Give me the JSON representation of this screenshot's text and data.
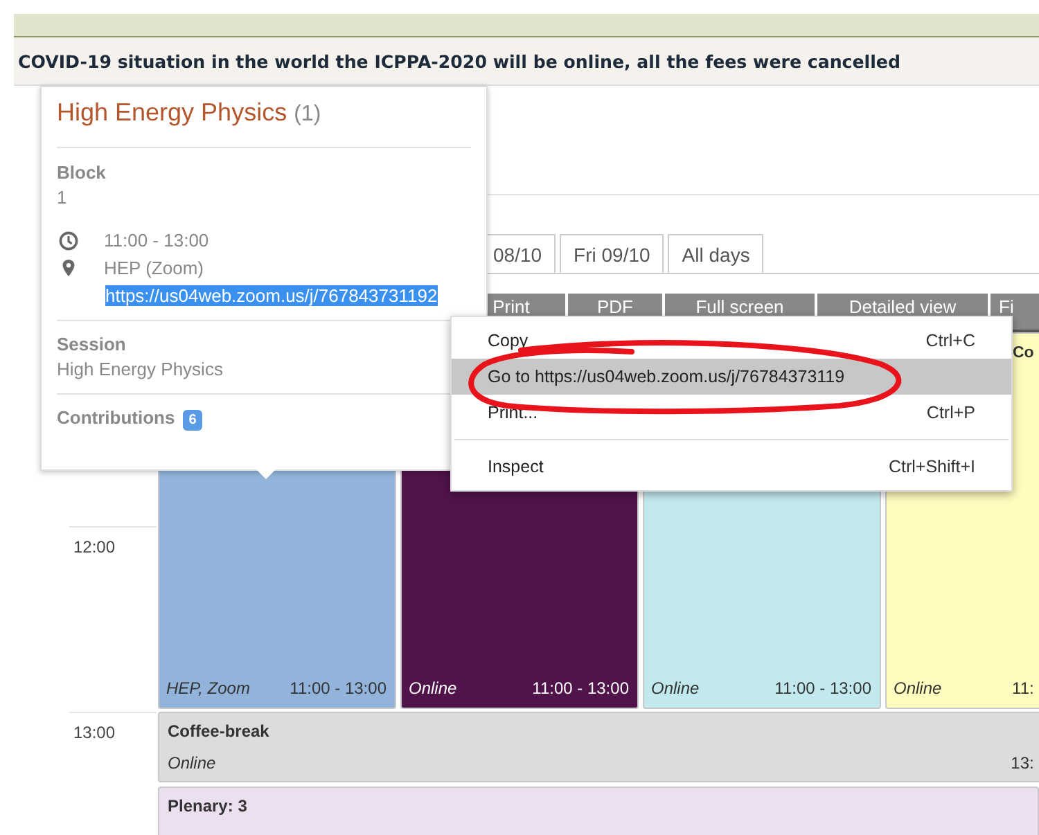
{
  "banner": "COVID-19 situation in the world the ICPPA-2020 will be online, all the fees were cancelled",
  "day_tabs": [
    {
      "label": "08/10",
      "selected": false
    },
    {
      "label": "Fri 09/10",
      "selected": false
    },
    {
      "label": "All days",
      "selected": false
    }
  ],
  "toolbar": [
    "Print",
    "PDF",
    "Full screen",
    "Detailed view",
    "Fi"
  ],
  "timetable": {
    "time_labels": [
      "12:00",
      "13:00"
    ],
    "blocks": [
      {
        "location": "HEP, Zoom",
        "time": "11:00 - 13:00",
        "color": "#92b4da"
      },
      {
        "location": "Online",
        "time": "11:00 - 13:00",
        "color": "#50134a"
      },
      {
        "location": "Online",
        "time": "11:00 - 13:00",
        "color": "#c2eaee"
      },
      {
        "title": "Co",
        "location": "Online",
        "time": "11:",
        "color": "#fefcbe"
      }
    ],
    "rows": [
      {
        "kind": "break",
        "title": "Coffee-break",
        "location": "Online",
        "time": "13:",
        "color": "#dcdcdc"
      },
      {
        "kind": "session",
        "title": "Plenary: 3",
        "color": "#ecdff0"
      }
    ]
  },
  "popup": {
    "title": "High Energy Physics",
    "count": "(1)",
    "block_label": "Block",
    "block_value": "1",
    "time": "11:00 - 13:00",
    "room": "HEP (Zoom)",
    "link": {
      "text": "https://us04web.zoom.us/j/767843731192",
      "selected": true
    },
    "session_label": "Session",
    "session_value": "High Energy Physics",
    "contributions_label": "Contributions",
    "contributions_count": "6"
  },
  "context_menu": {
    "groups": [
      [
        {
          "label": "Copy",
          "shortcut": "Ctrl+C",
          "selected": false
        },
        {
          "label": "Go to https://us04web.zoom.us/j/76784373119",
          "selected": true
        },
        {
          "label": "Print...",
          "shortcut": "Ctrl+P",
          "selected": false
        }
      ],
      [
        {
          "label": "Inspect",
          "shortcut": "Ctrl+Shift+I",
          "selected": false
        }
      ]
    ]
  }
}
